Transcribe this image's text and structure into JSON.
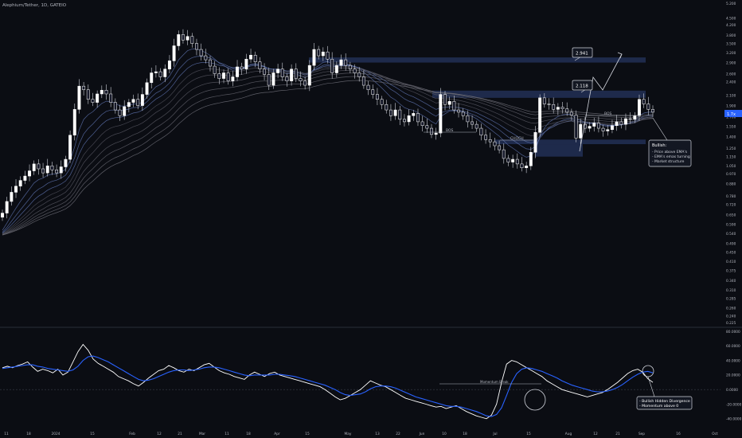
{
  "header": {
    "symbol": "Alephium/Tether, 1D, GATEIO"
  },
  "colors": {
    "background": "#0b0d13",
    "candle": "#e8e8ec",
    "zone": "#2a3a6a",
    "momentum": "#ffffff",
    "signal": "#2962ff",
    "text": "#b2b5be"
  },
  "chart_data": [
    {
      "type": "candlestick",
      "title": "Alephium/Tether, 1D, GATEIO",
      "y_scale": "log",
      "ylim": [
        0.225,
        5.2
      ],
      "y_ticks": [
        "5.200",
        "4.500",
        "4.200",
        "3.800",
        "3.500",
        "3.200",
        "2.900",
        "2.600",
        "2.400",
        "2.100",
        "1.900",
        "1.700",
        "1.550",
        "1.400",
        "1.250",
        "1.150",
        "1.050",
        "0.970",
        "0.880",
        "0.780",
        "0.720",
        "0.650",
        "0.590",
        "0.540",
        "0.490",
        "0.450",
        "0.410",
        "0.375",
        "0.340",
        "0.310",
        "0.285",
        "0.260",
        "0.240",
        "0.225"
      ],
      "x_ticks": [
        "11",
        "18",
        "2024",
        "15",
        "Feb",
        "12",
        "21",
        "Mar",
        "11",
        "18",
        "Apr",
        "15",
        "May",
        "13",
        "22",
        "Jun",
        "10",
        "18",
        "Jul",
        "15",
        "Aug",
        "12",
        "21",
        "Sep",
        "16",
        "Oct"
      ],
      "price_label": "1.7x",
      "approx_closes": [
        0.66,
        0.74,
        0.81,
        0.86,
        0.91,
        0.95,
        1.0,
        1.07,
        1.02,
        0.98,
        1.05,
        1.01,
        0.98,
        1.04,
        1.12,
        1.42,
        1.83,
        2.3,
        2.22,
        2.02,
        1.96,
        2.13,
        2.21,
        2.13,
        1.96,
        1.82,
        1.72,
        1.88,
        1.96,
        2.02,
        1.9,
        2.12,
        2.38,
        2.62,
        2.65,
        2.52,
        2.72,
        2.95,
        3.42,
        3.82,
        3.62,
        3.75,
        3.5,
        3.3,
        3.1,
        2.98,
        2.8,
        2.6,
        2.48,
        2.62,
        2.42,
        2.52,
        2.78,
        2.72,
        3.0,
        3.12,
        2.92,
        2.72,
        2.58,
        2.32,
        2.62,
        2.72,
        2.52,
        2.42,
        2.72,
        2.48,
        2.42,
        2.32,
        2.82,
        3.3,
        3.1,
        3.22,
        3.0,
        2.62,
        2.82,
        2.98,
        2.82,
        2.72,
        2.62,
        2.52,
        2.32,
        2.22,
        2.12,
        2.02,
        1.92,
        1.82,
        1.72,
        1.82,
        1.66,
        1.62,
        1.72,
        1.76,
        1.62,
        1.56,
        1.52,
        1.43,
        1.45,
        2.12,
        1.92,
        1.98,
        1.82,
        1.78,
        1.72,
        1.62,
        1.58,
        1.52,
        1.42,
        1.36,
        1.33,
        1.28,
        1.23,
        1.13,
        1.09,
        1.12,
        1.07,
        1.03,
        1.05,
        1.2,
        1.46,
        2.05,
        1.93,
        1.92,
        1.83,
        1.87,
        1.84,
        1.78,
        1.73,
        1.38,
        1.58,
        1.52,
        1.55,
        1.6,
        1.52,
        1.48,
        1.5,
        1.56,
        1.62,
        1.58,
        1.67,
        1.66,
        1.72,
        2.02,
        1.93,
        1.83,
        1.78
      ],
      "zones": [
        {
          "from_price": 2.9,
          "to_price": 3.05
        },
        {
          "from_price": 2.05,
          "to_price": 2.2
        },
        {
          "from_price": 1.3,
          "to_price": 1.36
        },
        {
          "from_price": 1.15,
          "to_price": 1.3
        }
      ],
      "annotations": [
        {
          "text": "2.941",
          "kind": "target"
        },
        {
          "text": "2.118",
          "kind": "target"
        },
        {
          "text": "BOS",
          "kind": "label"
        },
        {
          "text": "BOS",
          "kind": "label"
        },
        {
          "text": "CHOCH",
          "kind": "label"
        }
      ],
      "callout": [
        "Bullish:",
        "- Price above EMA's",
        "- EMA's emas turning",
        "- Market structure"
      ]
    },
    {
      "type": "line",
      "name": "Momentum",
      "ylim": [
        -50,
        80
      ],
      "y_ticks": [
        "80.0000",
        "60.0000",
        "40.0000",
        "20.0000",
        "0.0000",
        "-20.0000",
        "-40.0000"
      ],
      "series": [
        {
          "values": [
            30,
            32,
            30,
            33,
            35,
            38,
            31,
            25,
            28,
            26,
            23,
            28,
            20,
            24,
            38,
            52,
            62,
            54,
            42,
            36,
            32,
            28,
            24,
            18,
            15,
            12,
            8,
            5,
            10,
            16,
            21,
            26,
            28,
            33,
            30,
            26,
            24,
            28,
            26,
            30,
            34,
            36,
            31,
            26,
            23,
            21,
            18,
            16,
            14,
            20,
            24,
            21,
            18,
            22,
            24,
            20,
            18,
            16,
            14,
            12,
            10,
            8,
            6,
            4,
            0,
            -5,
            -10,
            -14,
            -12,
            -8,
            -4,
            0,
            6,
            12,
            9,
            6,
            4,
            0,
            -4,
            -8,
            -12,
            -14,
            -16,
            -18,
            -20,
            -22,
            -24,
            -23,
            -26,
            -24,
            -22,
            -26,
            -30,
            -33,
            -36,
            -38,
            -40,
            -35,
            -20,
            10,
            35,
            40,
            38,
            34,
            30,
            26,
            22,
            18,
            12,
            8,
            4,
            0,
            -2,
            -4,
            -6,
            -8,
            -10,
            -8,
            -6,
            -4,
            0,
            5,
            10,
            16,
            22,
            26,
            28,
            24,
            15,
            10
          ],
          "name_hidden": true
        },
        {
          "values": [
            29,
            30,
            31,
            32,
            33,
            34,
            34,
            32,
            31,
            29,
            28,
            27,
            26,
            25,
            27,
            32,
            40,
            45,
            46,
            44,
            41,
            38,
            34,
            30,
            26,
            22,
            18,
            14,
            12,
            13,
            15,
            18,
            21,
            24,
            26,
            27,
            27,
            26,
            27,
            28,
            30,
            31,
            31,
            30,
            28,
            26,
            24,
            22,
            20,
            19,
            20,
            20,
            20,
            20,
            21,
            21,
            20,
            19,
            18,
            16,
            14,
            12,
            10,
            8,
            6,
            3,
            0,
            -4,
            -7,
            -8,
            -7,
            -6,
            -3,
            1,
            4,
            5,
            5,
            4,
            2,
            -1,
            -4,
            -7,
            -10,
            -12,
            -14,
            -16,
            -18,
            -20,
            -22,
            -23,
            -23,
            -24,
            -26,
            -28,
            -30,
            -33,
            -36,
            -37,
            -34,
            -25,
            -8,
            10,
            22,
            28,
            30,
            29,
            27,
            25,
            22,
            19,
            16,
            12,
            9,
            6,
            4,
            2,
            0,
            -2,
            -3,
            -3,
            -2,
            0,
            3,
            7,
            12,
            17,
            21,
            24,
            25,
            23
          ]
        }
      ],
      "annotations": [
        "Momentum Break",
        "- Bullish Hidden Divergence",
        "- Momentum above 0"
      ]
    }
  ]
}
